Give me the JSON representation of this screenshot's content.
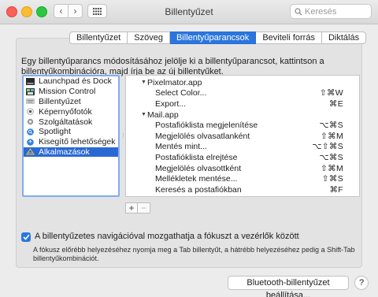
{
  "window": {
    "title": "Billentyűzet"
  },
  "toolbar": {
    "back_icon": "‹",
    "forward_icon": "›"
  },
  "search": {
    "placeholder": "Keresés"
  },
  "tabs": [
    {
      "label": "Billentyűzet"
    },
    {
      "label": "Szöveg"
    },
    {
      "label": "Billentyűparancsok",
      "active": true
    },
    {
      "label": "Beviteli forrás"
    },
    {
      "label": "Diktálás"
    }
  ],
  "description": "Egy billentyűparancs módosításához jelölje ki a billentyűparancsot, kattintson a billentyűkombinációra, majd írja be az új billentyűket.",
  "categories": [
    {
      "label": "Launchpad és Dock",
      "icon": "launchpad-dock-icon"
    },
    {
      "label": "Mission Control",
      "icon": "mission-control-icon"
    },
    {
      "label": "Billentyűzet",
      "icon": "keyboard-icon"
    },
    {
      "label": "Képernyőfotók",
      "icon": "screenshot-icon"
    },
    {
      "label": "Szolgáltatások",
      "icon": "services-gear-icon"
    },
    {
      "label": "Spotlight",
      "icon": "spotlight-icon"
    },
    {
      "label": "Kisegítő lehetőségek",
      "icon": "accessibility-icon"
    },
    {
      "label": "Alkalmazások",
      "icon": "apps-icon",
      "selected": true
    }
  ],
  "shortcuts": [
    {
      "type": "app",
      "label": "Pixelmator.app"
    },
    {
      "type": "cmd",
      "label": "Select Color...",
      "keys": "⇧⌘W"
    },
    {
      "type": "cmd",
      "label": "Export...",
      "keys": "⌘E"
    },
    {
      "type": "app",
      "label": "Mail.app"
    },
    {
      "type": "cmd",
      "label": "Postafióklista megjelenítése",
      "keys": "⌥⌘S"
    },
    {
      "type": "cmd",
      "label": "Megjelölés olvasatlanként",
      "keys": "⇧⌘M"
    },
    {
      "type": "cmd",
      "label": "Mentés mint...",
      "keys": "⌥⇧⌘S"
    },
    {
      "type": "cmd",
      "label": "Postafióklista elrejtése",
      "keys": "⌥⌘S"
    },
    {
      "type": "cmd",
      "label": "Megjelölés olvasottként",
      "keys": "⇧⌘M"
    },
    {
      "type": "cmd",
      "label": "Mellékletek mentése...",
      "keys": "⇧⌘S"
    },
    {
      "type": "cmd",
      "label": "Keresés a postafiókban",
      "keys": "⌘F"
    }
  ],
  "buttons": {
    "add": "+",
    "remove": "−",
    "bluetooth": "Bluetooth-billentyűzet beállítása...",
    "help": "?"
  },
  "navigation_option": {
    "checked": true,
    "label": "A billentyűzetes navigációval mozgathatja a fókuszt a vezérlők között",
    "hint": "A fókusz előrébb helyezéséhez nyomja meg a Tab billentyűt, a hátrébb helyezéséhez pedig a Shift-Tab billentyűkombinációt."
  },
  "colors": {
    "accent": "#2a76de",
    "selection": "#2a69d3"
  }
}
